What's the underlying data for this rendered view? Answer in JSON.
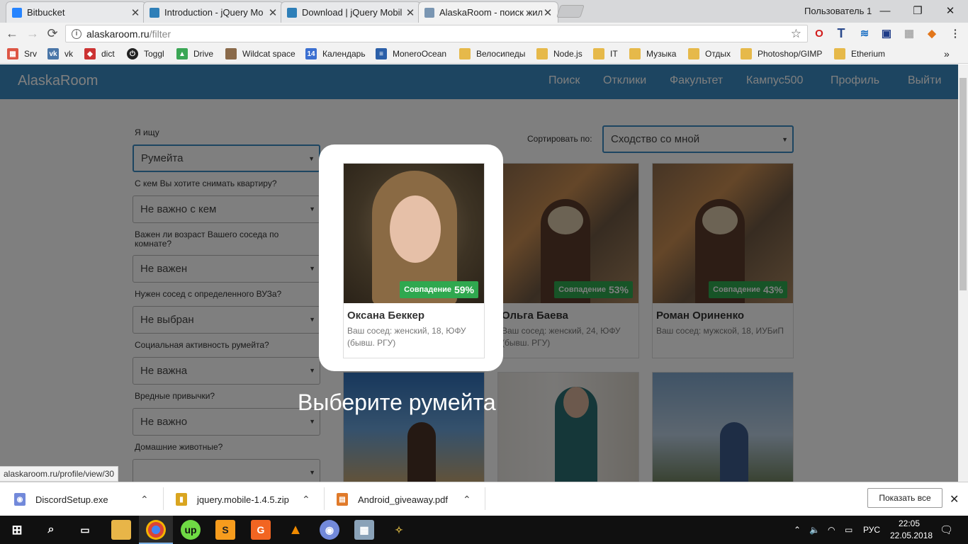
{
  "browser": {
    "tabs": [
      {
        "title": "Bitbucket",
        "color": "#2684ff"
      },
      {
        "title": "Introduction - jQuery Mo",
        "color": "#2e7fb8"
      },
      {
        "title": "Download | jQuery Mobil",
        "color": "#2e7fb8"
      },
      {
        "title": "AlaskaRoom - поиск жил",
        "color": "#7a96b2"
      }
    ],
    "user_label": "Пользователь 1",
    "window_buttons": {
      "minimize": "—",
      "maximize": "❐",
      "close": "✕"
    },
    "nav": {
      "back": "←",
      "forward": "→",
      "reload": "⟳"
    },
    "url_host": "alaskaroom.ru",
    "url_path": "/filter",
    "bookmarks": [
      {
        "label": "Srv",
        "color": "#d54"
      },
      {
        "label": "vk",
        "color": "#4a76a8"
      },
      {
        "label": "dict",
        "color": "#c33"
      },
      {
        "label": "Toggl",
        "color": "#222"
      },
      {
        "label": "Drive",
        "color": "#3aa655"
      },
      {
        "label": "Wildcat space",
        "color": "#8a6a4a"
      },
      {
        "label": "Календарь",
        "color": "#3b6fd1"
      },
      {
        "label": "MoneroOcean",
        "color": "#2b5fa8"
      },
      {
        "label": "Велосипеды",
        "color": "#e6b94a"
      },
      {
        "label": "Node.js",
        "color": "#e6b94a"
      },
      {
        "label": "IT",
        "color": "#e6b94a"
      },
      {
        "label": "Музыка",
        "color": "#e6b94a"
      },
      {
        "label": "Отдых",
        "color": "#e6b94a"
      },
      {
        "label": "Photoshop/GIMP",
        "color": "#e6b94a"
      },
      {
        "label": "Etherium",
        "color": "#e6b94a"
      }
    ],
    "bookmarks_more": "»",
    "status_url": "alaskaroom.ru/profile/view/30"
  },
  "site": {
    "brand": "AlaskaRoom",
    "nav": [
      "Поиск",
      "Отклики",
      "Факультет",
      "Кампус500",
      "Профиль",
      "Выйти"
    ],
    "colors": {
      "navbar": "#3b8bc2",
      "badge": "#2fa84f"
    },
    "filters": [
      {
        "label": "Я ищу",
        "value": "Румейта"
      },
      {
        "label": "С кем Вы хотите снимать квартиру?",
        "value": "Не важно с кем"
      },
      {
        "label": "Важен ли возраст Вашего соседа по комнате?",
        "value": "Не важен"
      },
      {
        "label": "Нужен сосед с определенного ВУЗа?",
        "value": "Не выбран"
      },
      {
        "label": "Социальная активность румейта?",
        "value": "Не важна"
      },
      {
        "label": "Вредные привычки?",
        "value": "Не важно"
      },
      {
        "label": "Домашние животные?",
        "value": ""
      }
    ],
    "sort_label": "Сортировать по:",
    "sort_value": "Сходство со мной",
    "match_prefix": "Совпадение",
    "cards": [
      {
        "name": "Оксана Беккер",
        "desc": "Ваш сосед: женский, 18, ЮФУ (бывш. РГУ)",
        "match": "59%"
      },
      {
        "name": "Ольга Баева",
        "desc": "Ваш сосед: женский, 24, ЮФУ (бывш. РГУ)",
        "match": "53%"
      },
      {
        "name": "Роман Ориненко",
        "desc": "Ваш сосед: мужской, 18, ИУБиП",
        "match": "43%"
      }
    ],
    "overlay_hint": "Выберите румейта"
  },
  "downloads": {
    "items": [
      {
        "name": "DiscordSetup.exe",
        "color": "#7289da"
      },
      {
        "name": "jquery.mobile-1.4.5.zip",
        "color": "#d9a520"
      },
      {
        "name": "Android_giveaway.pdf",
        "color": "#e07a2a"
      }
    ],
    "show_all": "Показать все",
    "close": "✕",
    "chevron": "⌃"
  },
  "taskbar": {
    "lang": "РУС",
    "time": "22:05",
    "date": "22.05.2018"
  }
}
